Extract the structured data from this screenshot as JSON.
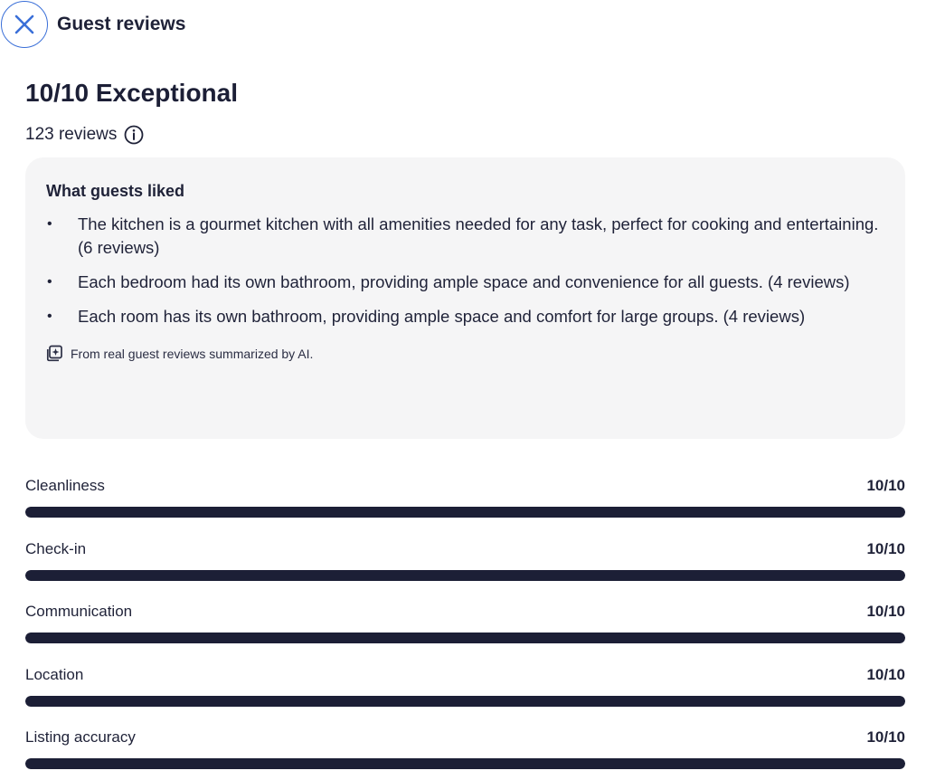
{
  "header": {
    "title": "Guest reviews",
    "close_icon": "close-icon"
  },
  "rating": {
    "title": "10/10 Exceptional",
    "count_text": "123 reviews",
    "info_icon": "info-icon"
  },
  "summary": {
    "heading": "What guests liked",
    "items": [
      {
        "text": "The kitchen is a gourmet kitchen with all amenities needed for any task, perfect for cooking and entertaining. (6 reviews)"
      },
      {
        "text": "Each bedroom had its own bathroom, providing ample space and convenience for all guests. (4 reviews)"
      },
      {
        "text": "Each room has its own bathroom, providing ample space and comfort for large groups. (4 reviews)"
      }
    ],
    "ai_note": "From real guest reviews summarized by AI.",
    "ai_icon": "ai-summary-icon"
  },
  "scores": [
    {
      "label": "Cleanliness",
      "value_text": "10/10",
      "fraction": 1.0
    },
    {
      "label": "Check-in",
      "value_text": "10/10",
      "fraction": 1.0
    },
    {
      "label": "Communication",
      "value_text": "10/10",
      "fraction": 1.0
    },
    {
      "label": "Location",
      "value_text": "10/10",
      "fraction": 1.0
    },
    {
      "label": "Listing accuracy",
      "value_text": "10/10",
      "fraction": 1.0
    }
  ],
  "colors": {
    "accent_blue": "#3a6fd8",
    "text_dark": "#1f2238",
    "bar_fill": "#1c1f36",
    "card_bg": "#f5f5f6"
  }
}
